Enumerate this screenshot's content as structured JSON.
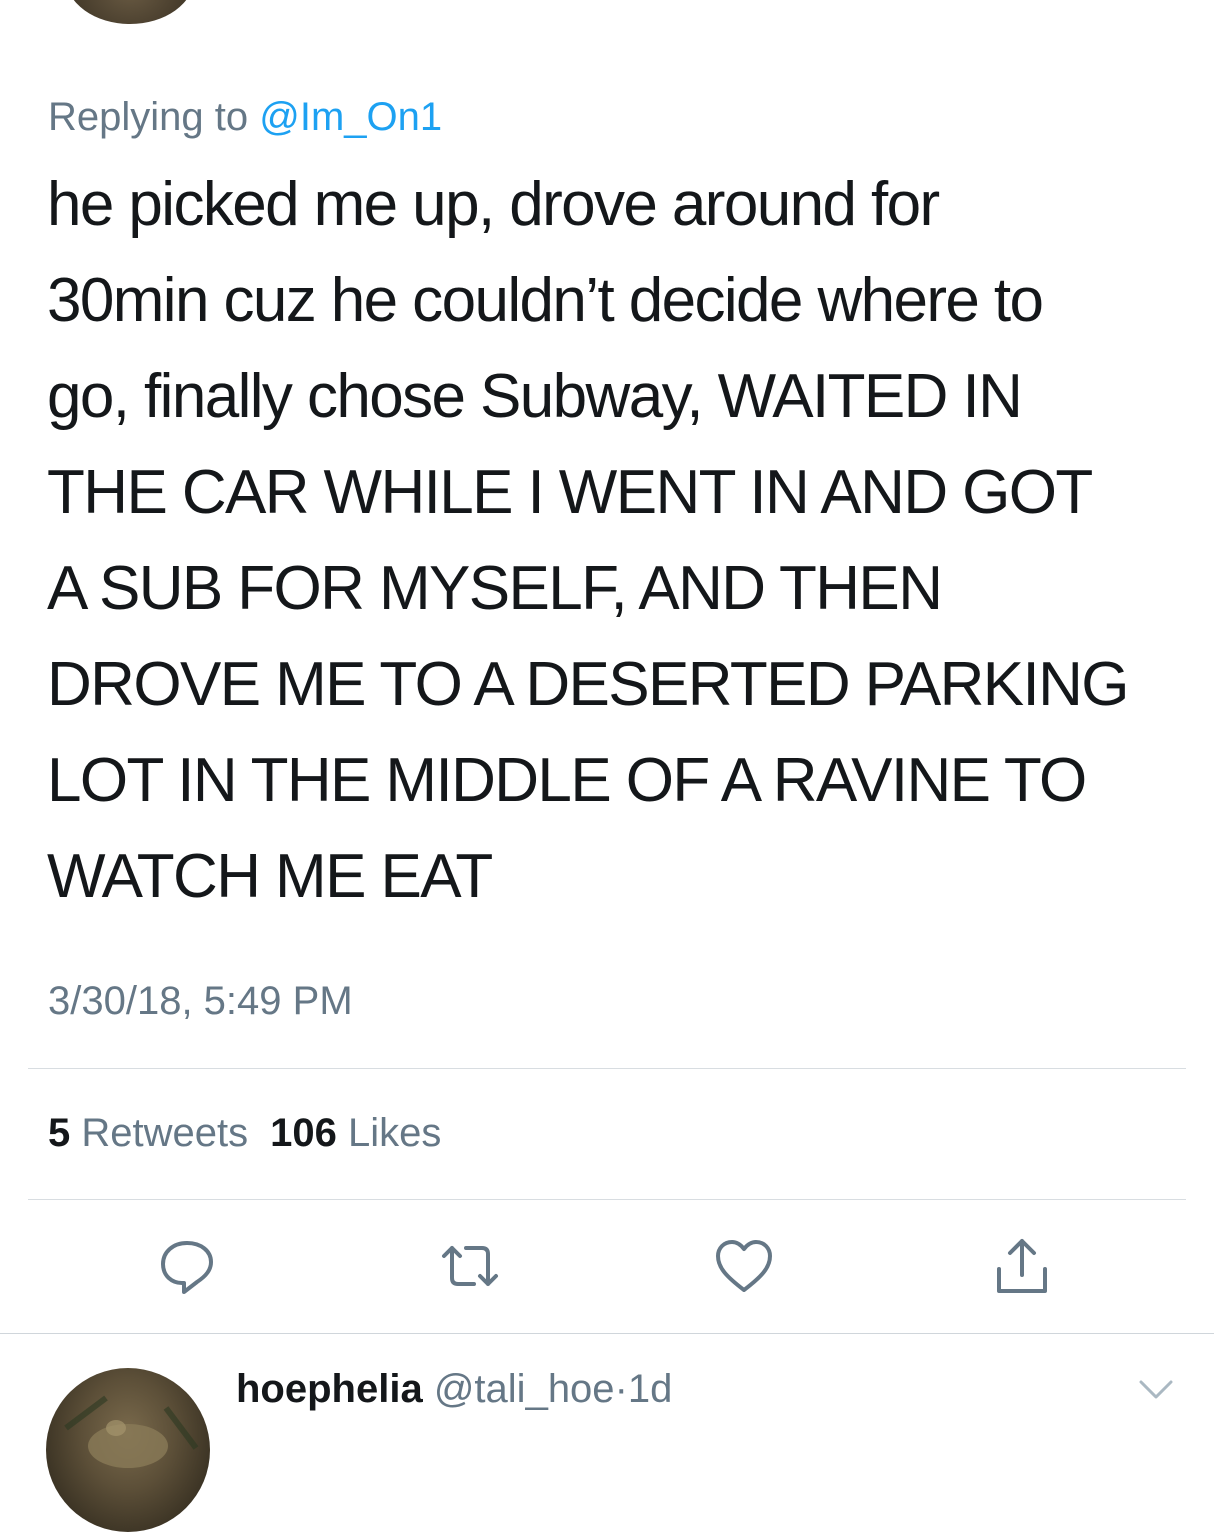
{
  "tweet": {
    "replying_prefix": "Replying to ",
    "replying_handle": "@Im_On1",
    "text_lines": [
      "he picked me up, drove around for",
      "30min cuz he couldn’t decide where to",
      "go, finally chose Subway, WAITED IN",
      "THE CAR WHILE I WENT IN AND GOT",
      "A SUB FOR MYSELF, AND THEN",
      "DROVE ME TO A DESERTED PARKING",
      "LOT IN THE MIDDLE OF A RAVINE TO",
      "WATCH ME EAT"
    ],
    "timestamp": "3/30/18, 5:49 PM",
    "retweets_count": "5",
    "retweets_label": "Retweets",
    "likes_count": "106",
    "likes_label": "Likes"
  },
  "actions": [
    {
      "icon": "reply-icon"
    },
    {
      "icon": "retweet-icon"
    },
    {
      "icon": "like-icon"
    },
    {
      "icon": "share-icon"
    }
  ],
  "reply": {
    "display_name": "hoephelia",
    "handle": "@tali_hoe",
    "separator": "·",
    "age": "1d"
  },
  "colors": {
    "text_primary": "#14171a",
    "text_secondary": "#657786",
    "link": "#1da1f2",
    "divider": "#d8dde1"
  }
}
